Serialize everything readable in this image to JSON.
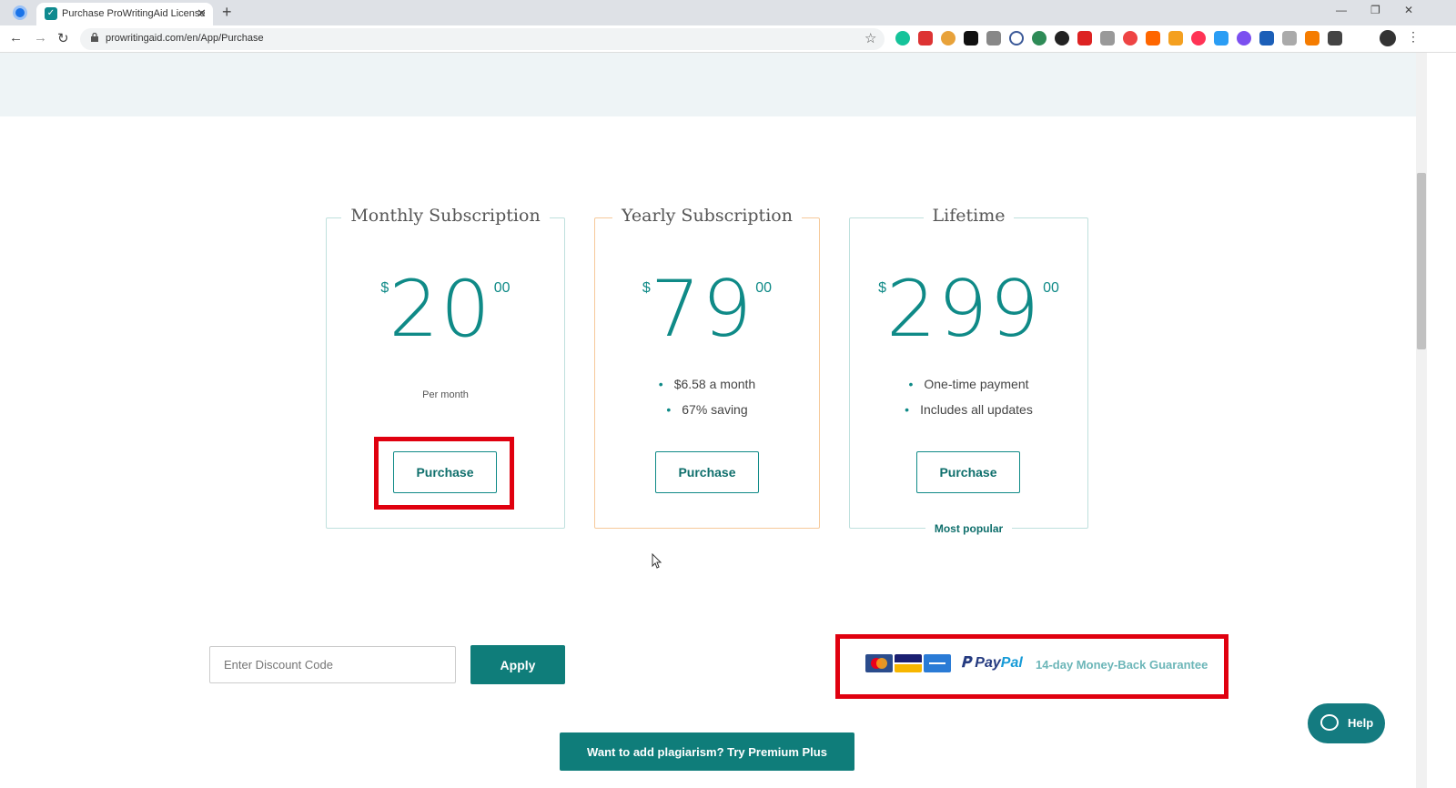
{
  "browser": {
    "tab_title": "Purchase ProWritingAid License",
    "tab_close": "✕",
    "new_tab": "+",
    "url": "prowritingaid.com/en/App/Purchase",
    "back": "←",
    "forward": "→",
    "reload": "↻",
    "star": "☆",
    "menu": "⋮",
    "win_min": "—",
    "win_restore": "❐",
    "win_close": "✕"
  },
  "plans": [
    {
      "title": "Monthly Subscription",
      "currency": "$",
      "amount": "20",
      "cents": "00",
      "note": "Per month",
      "button": "Purchase"
    },
    {
      "title": "Yearly Subscription",
      "currency": "$",
      "amount": "79",
      "cents": "00",
      "bullets": [
        "$6.58 a month",
        "67% saving"
      ],
      "button": "Purchase"
    },
    {
      "title": "Lifetime",
      "currency": "$",
      "amount": "299",
      "cents": "00",
      "bullets": [
        "One-time payment",
        "Includes all updates"
      ],
      "button": "Purchase",
      "badge": "Most popular"
    }
  ],
  "discount": {
    "placeholder": "Enter Discount Code",
    "apply_label": "Apply"
  },
  "payment": {
    "paypal_pay": "Pay",
    "paypal_pal": "Pal",
    "guarantee": "14-day Money-Back Guarantee"
  },
  "premium_label": "Want to add plagiarism? Try Premium Plus",
  "help_label": "Help",
  "colors": {
    "accent": "#0f7d7a",
    "highlight": "#e0000f",
    "yearly_border": "#f6c99a"
  }
}
